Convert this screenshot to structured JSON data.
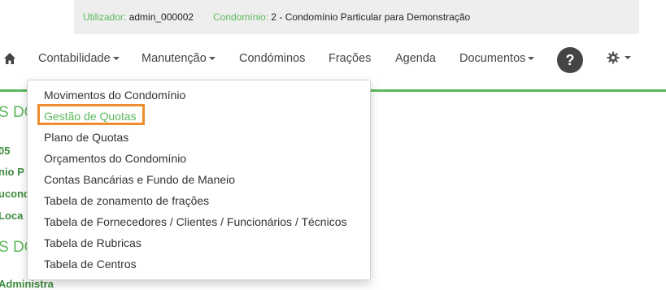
{
  "userbar": {
    "user_label": "Utilizador:",
    "user_value": "admin_000002",
    "condo_label": "Condomínio:",
    "condo_value": "2 - Condomínio Particular para Demonstração"
  },
  "nav": {
    "home_icon": "home-icon",
    "items": [
      {
        "label": "Contabilidade",
        "dropdown": true
      },
      {
        "label": "Manutenção",
        "dropdown": true
      },
      {
        "label": "Condóminos",
        "dropdown": false
      },
      {
        "label": "Frações",
        "dropdown": false
      },
      {
        "label": "Agenda",
        "dropdown": false
      },
      {
        "label": "Documentos",
        "dropdown": true
      }
    ],
    "help_label": "?",
    "settings_icon": "gear-icon"
  },
  "background": {
    "heading1": "S DO",
    "line1": "05",
    "line2": "nio P",
    "line3": "ucond",
    "line4": "Loca",
    "heading2": "S DO",
    "line5": "Administra"
  },
  "dropdown": {
    "items": [
      "Movimentos do Condomínio",
      "Gestão de Quotas",
      "Plano de Quotas",
      "Orçamentos do Condomínio",
      "Contas Bancárias e Fundo de Maneio",
      "Tabela de zonamento de frações",
      "Tabela de Fornecedores / Clientes / Funcionários / Técnicos",
      "Tabela de Rubricas",
      "Tabela de Centros"
    ],
    "highlighted_index": 1
  },
  "colors": {
    "accent": "#5cb85c",
    "highlight": "#f08c2e"
  }
}
